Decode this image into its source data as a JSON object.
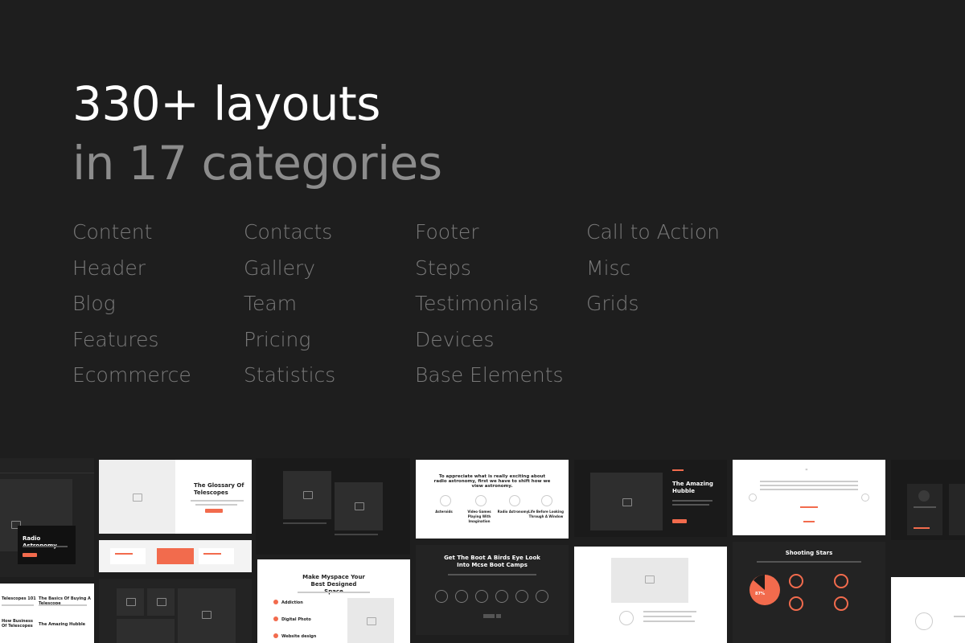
{
  "hero": {
    "line1": "330+ layouts",
    "line2": "in 17 categories"
  },
  "categories": [
    "Content",
    "Header",
    "Blog",
    "Features",
    "Ecommerce",
    "Contacts",
    "Gallery",
    "Team",
    "Pricing",
    "Statistics",
    "Footer",
    "Steps",
    "Testimonials",
    "Devices",
    "Base Elements",
    "Call to Action",
    "Misc",
    "Grids"
  ],
  "thumbnails": {
    "radio_title": "Radio Astronomy",
    "glossary_title": "The Glossary Of Telescopes",
    "appreciate_text": "To appreciate what is really exciting about radio astronomy, first we have to shift how we view astronomy.",
    "step_labels": [
      "Asteroids",
      "Video Games Playing With Imagination",
      "Radio Astronomy",
      "Life Before Looking Through A Window"
    ],
    "hubble_title": "The Amazing Hubble",
    "boot_title": "Get The Boot A Birds Eye Look Into Mcse Boot Camps",
    "myspace_title": "Make Myspace Your Best Designed Space",
    "myspace_items": [
      "Addiction",
      "Digital Photo",
      "Website design"
    ],
    "shooting_title": "Shooting Stars",
    "pie_value": "87%",
    "blog_items": [
      "Telescopes 101",
      "The Basics Of Buying A Telescope",
      "How Business Of Telescopes",
      "The Amazing Hubble"
    ],
    "colors": {
      "accent": "#f26b4d",
      "background": "#1e1e1e"
    }
  }
}
